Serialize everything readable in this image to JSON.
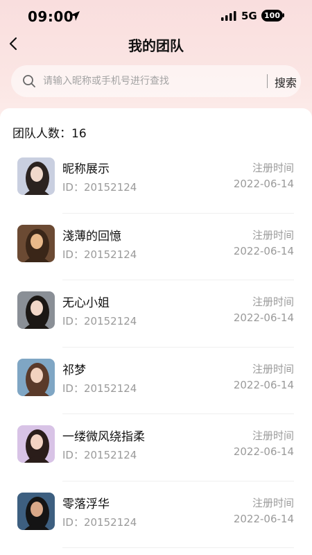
{
  "status_bar": {
    "time": "09:00",
    "network": "5G",
    "battery": "100"
  },
  "header": {
    "title": "我的团队"
  },
  "search": {
    "placeholder": "请输入昵称或手机号进行查找",
    "button_label": "搜索"
  },
  "team": {
    "count_label": "团队人数：16"
  },
  "members": [
    {
      "nickname": "昵称展示",
      "id_text": "ID：20152124",
      "reg_label": "注册时间",
      "reg_date": "2022-06-14",
      "avatar_colors": [
        "#c9cfe0",
        "#2b2320",
        "#f0d9cc"
      ]
    },
    {
      "nickname": "淺薄的回憶",
      "id_text": "ID：20152124",
      "reg_label": "注册时间",
      "reg_date": "2022-06-14",
      "avatar_colors": [
        "#6b4a33",
        "#3a2618",
        "#e9b98a"
      ]
    },
    {
      "nickname": "无心小姐",
      "id_text": "ID：20152124",
      "reg_label": "注册时间",
      "reg_date": "2022-06-14",
      "avatar_colors": [
        "#8a8f96",
        "#1b1714",
        "#f1d7c8"
      ]
    },
    {
      "nickname": "祁梦",
      "id_text": "ID：20152124",
      "reg_label": "注册时间",
      "reg_date": "2022-06-14",
      "avatar_colors": [
        "#7fa6c4",
        "#5a3a2a",
        "#f2d2bf"
      ]
    },
    {
      "nickname": "一缕微风绕指柔",
      "id_text": "ID：20152124",
      "reg_label": "注册时间",
      "reg_date": "2022-06-14",
      "avatar_colors": [
        "#d8c3e6",
        "#2a1d1a",
        "#f3d3c3"
      ]
    },
    {
      "nickname": "零落浮华",
      "id_text": "ID：20152124",
      "reg_label": "注册时间",
      "reg_date": "2022-06-14",
      "avatar_colors": [
        "#3d5f80",
        "#141414",
        "#d8a888"
      ]
    }
  ]
}
